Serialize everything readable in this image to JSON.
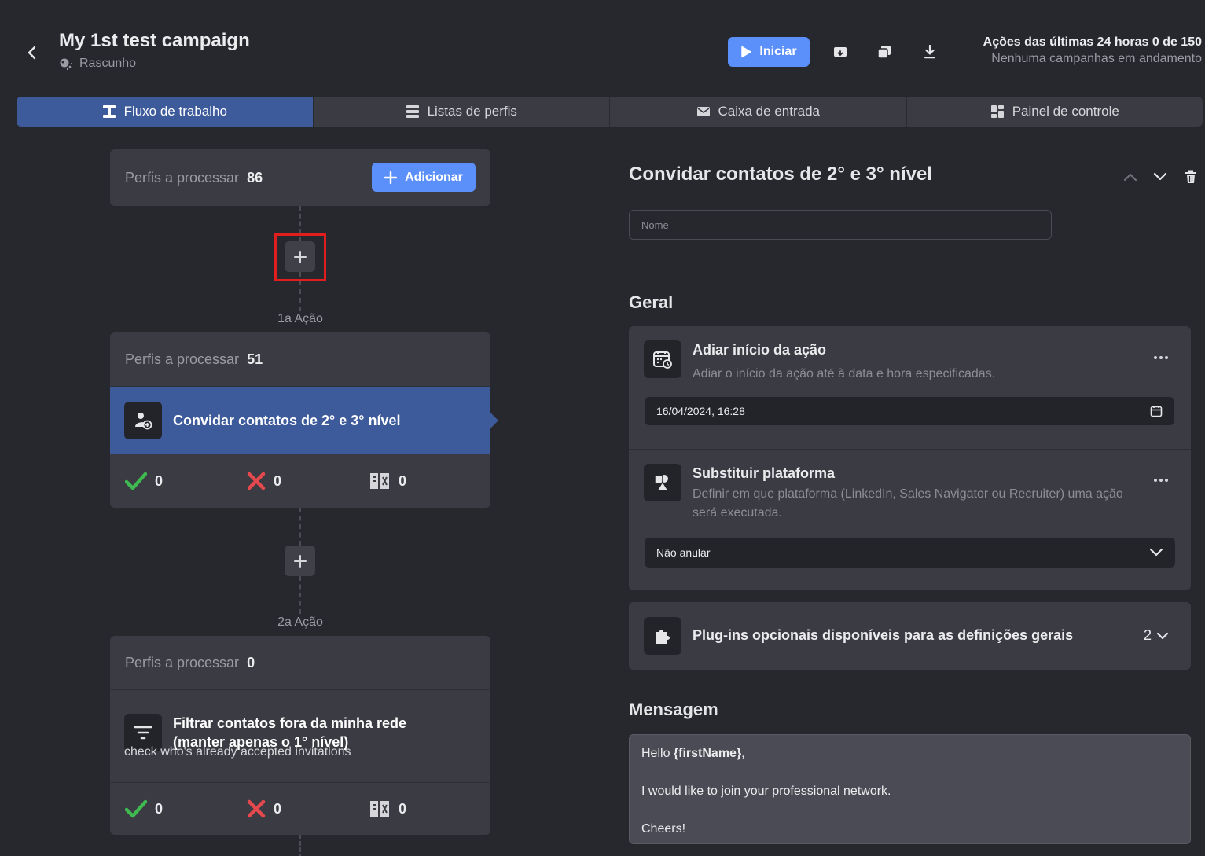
{
  "header": {
    "title": "My 1st test campaign",
    "status": "Rascunho",
    "start_label": "Iniciar",
    "stats_line1": "Ações das últimas 24 horas 0 de 150",
    "stats_line2": "Nenhuma campanhas em andamento"
  },
  "tabs": [
    {
      "label": "Fluxo de trabalho",
      "icon": "workflow-icon",
      "active": true
    },
    {
      "label": "Listas de perfis",
      "icon": "list-icon",
      "active": false
    },
    {
      "label": "Caixa de entrada",
      "icon": "mail-icon",
      "active": false
    },
    {
      "label": "Painel de controle",
      "icon": "dashboard-icon",
      "active": false
    }
  ],
  "workflow": {
    "start": {
      "label": "Perfis a processar",
      "count": "86",
      "add_label": "Adicionar"
    },
    "steps": [
      {
        "step_label": "1a Ação",
        "profiles_label": "Perfis a processar",
        "profiles_count": "51",
        "action_name": "Convidar contatos de 2° e 3° nível",
        "success": "0",
        "failed": "0",
        "skipped": "0"
      },
      {
        "step_label": "2a Ação",
        "profiles_label": "Perfis a processar",
        "profiles_count": "0",
        "action_name": "Filtrar contatos fora da minha rede (manter apenas o 1° nível)",
        "action_note": "check who's already accepted invitations",
        "success": "0",
        "failed": "0",
        "skipped": "0"
      }
    ]
  },
  "detail": {
    "title": "Convidar contatos de 2° e 3° nível",
    "name_placeholder": "Nome",
    "general_title": "Geral",
    "delay": {
      "title": "Adiar início da ação",
      "desc": "Adiar o início da ação até à data e hora especificadas.",
      "value": "16/04/2024, 16:28"
    },
    "platform": {
      "title": "Substituir plataforma",
      "desc": "Definir em que plataforma (LinkedIn, Sales Navigator ou Recruiter) uma ação será executada.",
      "value": "Não anular"
    },
    "plugins": {
      "title": "Plug-ins opcionais disponíveis para as definições gerais",
      "count": "2"
    },
    "message_title": "Mensagem",
    "message": {
      "greeting": "Hello ",
      "variable": "{firstName}",
      "greeting_end": ",",
      "body": "I would like to join your professional network.",
      "closing": "Cheers!"
    }
  },
  "colors": {
    "accent": "#5b8ff9",
    "active_tab": "#3d5a9a",
    "success": "#3fb950",
    "error": "#e5484d",
    "highlight": "#e11d1d"
  }
}
